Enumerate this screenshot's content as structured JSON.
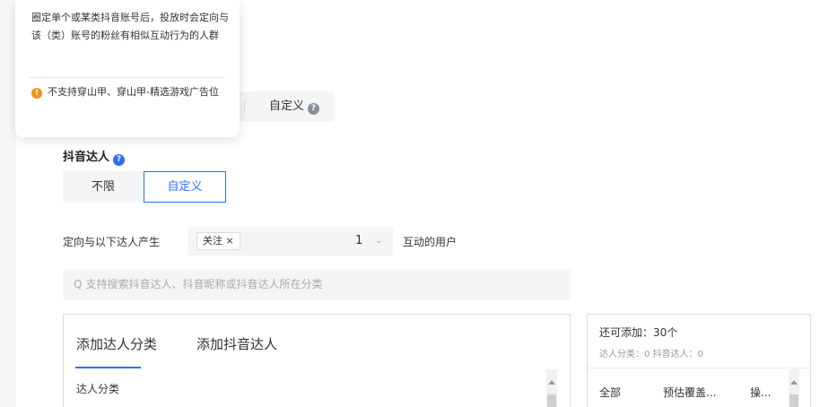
{
  "tooltip": {
    "description": "圈定单个或某类抖音账号后，投放时会定向与该（类）账号的粉丝有相似互动行为的人群",
    "warning_icon": "!",
    "warning": "不支持穿山甲、穿山甲-精选游戏广告位"
  },
  "top_segment": {
    "custom_label": "自定义"
  },
  "help_glyph": "?",
  "douyin_section": {
    "label": "抖音达人",
    "option_unlimited": "不限",
    "option_custom": "自定义"
  },
  "targeting": {
    "prefix": "定向与以下达人产生",
    "tag": "关注 ×",
    "count": "1",
    "chevron": "⌄",
    "suffix": "互动的用户"
  },
  "search": {
    "icon": "Q",
    "placeholder": "支持搜索抖音达人、抖音昵称或抖音达人所在分类"
  },
  "left_panel": {
    "tabs": [
      "添加达人分类",
      "添加抖音达人"
    ],
    "subheader": "达人分类"
  },
  "right_panel": {
    "title": "还可添加：30个",
    "subtitle": "达人分类：0   抖音达人：0",
    "columns": [
      "全部",
      "预估覆盖...",
      "操..."
    ]
  },
  "colors": {
    "accent": "#2c6ef2",
    "warning": "#f29219"
  }
}
